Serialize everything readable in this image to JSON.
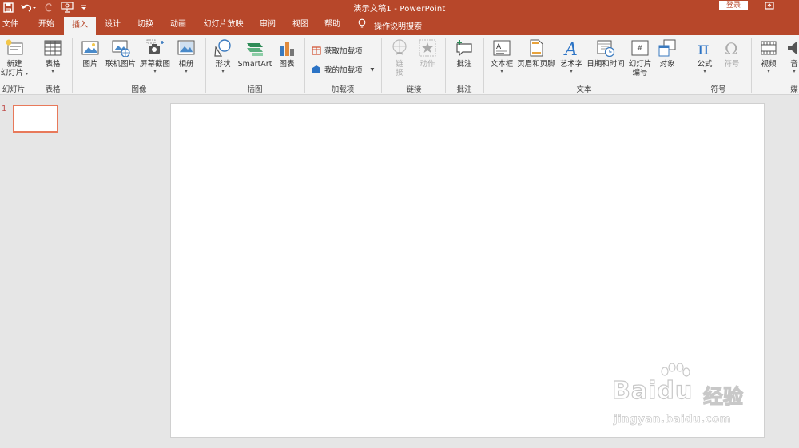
{
  "titlebar": {
    "title": "演示文稿1  -  PowerPoint",
    "login": "登录",
    "qat_icons": [
      "save-icon",
      "undo-icon",
      "redo-icon",
      "present-from-start-icon",
      "customize-qat-icon"
    ]
  },
  "tabs": [
    {
      "label": "文件"
    },
    {
      "label": "开始"
    },
    {
      "label": "插入"
    },
    {
      "label": "设计"
    },
    {
      "label": "切换"
    },
    {
      "label": "动画"
    },
    {
      "label": "幻灯片放映"
    },
    {
      "label": "审阅"
    },
    {
      "label": "视图"
    },
    {
      "label": "帮助"
    }
  ],
  "active_tab": "插入",
  "search": {
    "label": "操作说明搜索",
    "icon": "lightbulb-icon"
  },
  "ribbon": {
    "slides_group": {
      "new_slide_line1": "新建",
      "new_slide_line2": "幻灯片",
      "label": "幻灯片"
    },
    "table_group": {
      "table": "表格",
      "label": "表格"
    },
    "images_group": {
      "picture": "图片",
      "online_picture": "联机图片",
      "screenshot": "屏幕截图",
      "album": "相册",
      "label": "图像"
    },
    "illustrations_group": {
      "shapes": "形状",
      "smartart": "SmartArt",
      "chart": "图表",
      "label": "插图"
    },
    "addins_group": {
      "get_addins": "获取加载项",
      "my_addins": "我的加载项",
      "label": "加载项"
    },
    "links_group": {
      "link_line1": "链",
      "link_line2": "接",
      "action": "动作",
      "label": "链接"
    },
    "comments_group": {
      "comment": "批注",
      "label": "批注"
    },
    "text_group": {
      "textbox": "文本框",
      "header_footer": "页眉和页脚",
      "wordart": "艺术字",
      "datetime": "日期和时间",
      "slide_number_line1": "幻灯片",
      "slide_number_line2": "编号",
      "object": "对象",
      "label": "文本"
    },
    "symbols_group": {
      "equation": "公式",
      "symbol": "符号",
      "label": "符号"
    },
    "media_group": {
      "video": "视频",
      "audio": "音",
      "label": "媒"
    }
  },
  "slides_pane": {
    "slide_number": "1"
  },
  "watermark": {
    "brand": "Baidu",
    "brand_cn": "经验",
    "url": "jingyan.baidu.com"
  },
  "colors": {
    "accent": "#b7472a",
    "ribbon_bg": "#f3f3f3",
    "workspace_bg": "#e6e6e6",
    "selected_thumb_border": "#e8795a"
  }
}
